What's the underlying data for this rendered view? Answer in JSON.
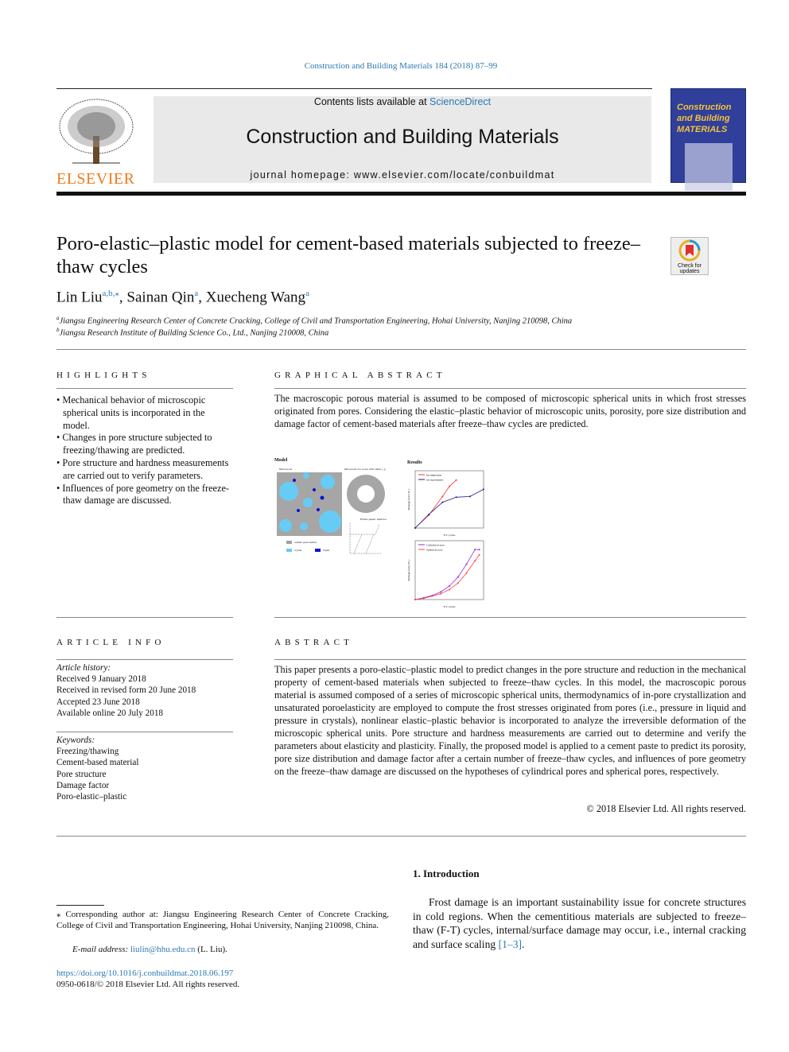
{
  "journal_ref": "Construction and Building Materials 184 (2018) 87–99",
  "header": {
    "contents_prefix": "Contents lists available at ",
    "sciencedirect": "ScienceDirect",
    "journal_title": "Construction and Building Materials",
    "homepage": "journal homepage: www.elsevier.com/locate/conbuildmat",
    "publisher": "ELSEVIER",
    "cover_title": "Construction and Building MATERIALS"
  },
  "check_updates": "Check for updates",
  "article": {
    "title": "Poro-elastic–plastic model for cement-based materials subjected to freeze–thaw cycles",
    "authors": [
      {
        "name": "Lin Liu",
        "sup": "a,b,⁎"
      },
      {
        "name": "Sainan Qin",
        "sup": "a"
      },
      {
        "name": "Xuecheng Wang",
        "sup": "a"
      }
    ],
    "affiliations": [
      {
        "sup": "a",
        "text": "Jiangsu Engineering Research Center of Concrete Cracking, College of Civil and Transportation Engineering, Hohai University, Nanjing 210098, China"
      },
      {
        "sup": "b",
        "text": "Jiangsu Research Institute of Building Science Co., Ltd., Nanjing 210008, China"
      }
    ]
  },
  "highlights": {
    "heading": "HIGHLIGHTS",
    "items": [
      "Mechanical behavior of microscopic spherical units is incorporated in the model.",
      "Changes in pore structure subjected to freezing/thawing are predicted.",
      "Pore structure and hardness measurements are carried out to verify parameters.",
      "Influences of pore geometry on the freeze-thaw damage are discussed."
    ]
  },
  "graphical_abstract": {
    "heading": "GRAPHICAL ABSTRACT",
    "text": "The macroscopic porous material is assumed to be composed of microscopic spherical units in which frost stresses originated from pores. Considering the elastic–plastic behavior of microscopic units, porosity, pore size distribution and damage factor of cement-based materials after freeze–thaw cycles are predicted.",
    "figure": {
      "model_label": "Model",
      "results_label": "Results",
      "macroscale": "Macroscale",
      "microscale": "Microscale, for pores with radius r_p",
      "elastic_plastic": "Elastic-plastic behavior",
      "legend": [
        "cement paste matrix",
        "crystal",
        "liquid"
      ],
      "legend_colors": [
        "#a0a0a0",
        "#66ccf5",
        "#0a14d8"
      ],
      "chart1": {
        "ylabel": "Damage factor D_r",
        "xlabel": "F-T cycles",
        "series": [
          {
            "name": "by simulation",
            "color": "#ff3030",
            "x": [
              0,
              2,
              4,
              5,
              6
            ],
            "y": [
              0,
              0.18,
              0.44,
              0.58,
              0.67
            ]
          },
          {
            "name": "by experiments",
            "color": "#1a1a8a",
            "x": [
              0,
              2,
              4,
              6,
              8,
              10
            ],
            "y": [
              0,
              0.19,
              0.36,
              0.43,
              0.44,
              0.54
            ]
          }
        ],
        "xlim": [
          0,
          10
        ],
        "ylim": [
          0,
          0.8
        ]
      },
      "chart2": {
        "ylabel": "Damage factor D_r",
        "xlabel": "F-T cycles",
        "series": [
          {
            "name": "Cylindrical pore",
            "color": "#8a2be2",
            "x": [
              0,
              2,
              4,
              6,
              8,
              10,
              12,
              14,
              15
            ],
            "y": [
              0,
              0.03,
              0.07,
              0.13,
              0.23,
              0.38,
              0.6,
              0.85,
              0.85
            ]
          },
          {
            "name": "Spherical pore",
            "color": "#ff4040",
            "x": [
              0,
              2,
              4,
              6,
              8,
              10,
              12,
              14,
              15
            ],
            "y": [
              0,
              0.02,
              0.06,
              0.1,
              0.17,
              0.28,
              0.45,
              0.66,
              0.76
            ]
          }
        ],
        "xlim": [
          0,
          16
        ],
        "ylim": [
          0,
          1
        ]
      }
    }
  },
  "article_info": {
    "heading": "ARTICLE INFO",
    "history_label": "Article history:",
    "history": [
      "Received 9 January 2018",
      "Received in revised form 20 June 2018",
      "Accepted 23 June 2018",
      "Available online 20 July 2018"
    ],
    "keywords_label": "Keywords:",
    "keywords": [
      "Freezing/thawing",
      "Cement-based material",
      "Pore structure",
      "Damage factor",
      "Poro-elastic–plastic"
    ]
  },
  "abstract": {
    "heading": "ABSTRACT",
    "text": "This paper presents a poro-elastic–plastic model to predict changes in the pore structure and reduction in the mechanical property of cement-based materials when subjected to freeze–thaw cycles. In this model, the macroscopic porous material is assumed composed of a series of microscopic spherical units, thermodynamics of in-pore crystallization and unsaturated poroelasticity are employed to compute the frost stresses originated from pores (i.e., pressure in liquid and pressure in crystals), nonlinear elastic–plastic behavior is incorporated to analyze the irreversible deformation of the microscopic spherical units. Pore structure and hardness measurements are carried out to determine and verify the parameters about elasticity and plasticity. Finally, the proposed model is applied to a cement paste to predict its porosity, pore size distribution and damage factor after a certain number of freeze–thaw cycles, and influences of pore geometry on the freeze–thaw damage are discussed on the hypotheses of cylindrical pores and spherical pores, respectively.",
    "copyright": "© 2018 Elsevier Ltd. All rights reserved."
  },
  "footnote": {
    "corresponding": "⁎ Corresponding author at: Jiangsu Engineering Research Center of Concrete Cracking, College of Civil and Transportation Engineering, Hohai University, Nanjing 210098, China.",
    "email_label": "E-mail address: ",
    "email": "liulin@hhu.edu.cn",
    "email_suffix": " (L. Liu).",
    "doi": "https://doi.org/10.1016/j.conbuildmat.2018.06.197",
    "issn": "0950-0618/© 2018 Elsevier Ltd. All rights reserved."
  },
  "introduction": {
    "heading": "1. Introduction",
    "text": "Frost damage is an important sustainability issue for concrete structures in cold regions. When the cementitious materials are subjected to freeze–thaw (F-T) cycles, internal/surface damage may occur, i.e., internal cracking and surface scaling ",
    "ref": "[1–3]",
    "end": "."
  }
}
